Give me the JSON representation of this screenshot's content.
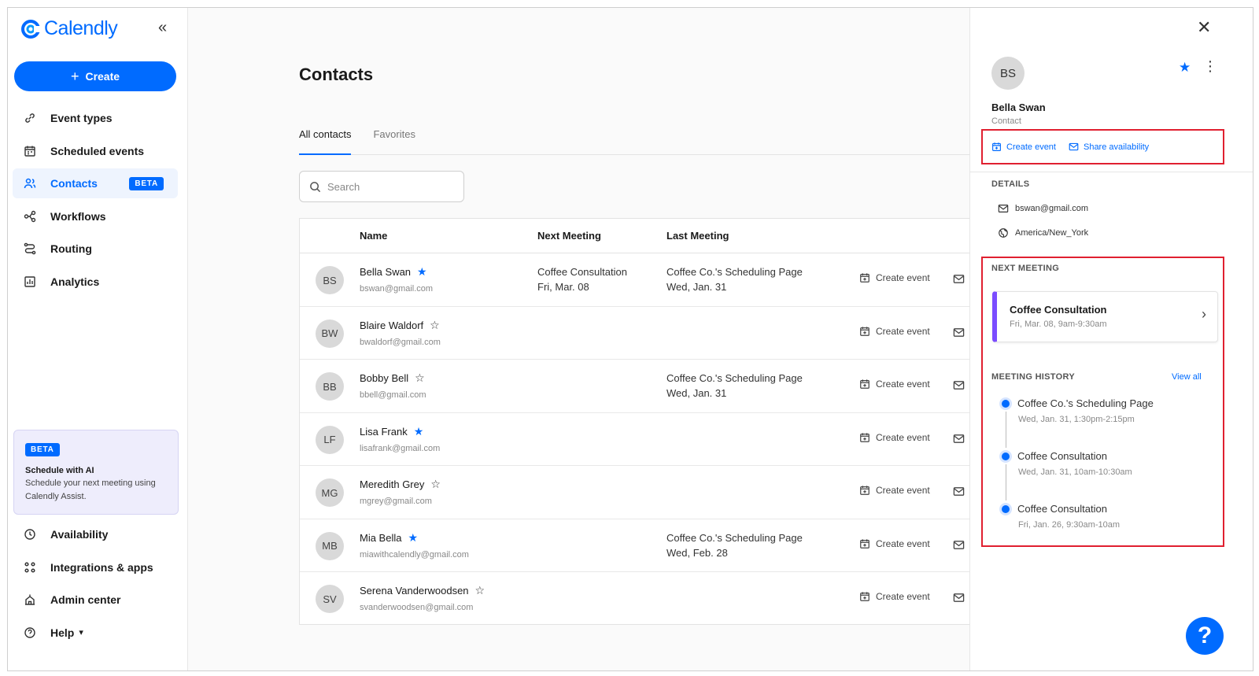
{
  "app": {
    "logo_text": "Calendly",
    "collapse_glyph": "«"
  },
  "sidebar": {
    "create_label": "Create",
    "items": [
      {
        "label": "Event types",
        "icon": "link-icon"
      },
      {
        "label": "Scheduled events",
        "icon": "calendar-icon"
      },
      {
        "label": "Contacts",
        "icon": "contacts-icon",
        "badge": "BETA",
        "active": true
      },
      {
        "label": "Workflows",
        "icon": "workflow-icon"
      },
      {
        "label": "Routing",
        "icon": "routing-icon"
      },
      {
        "label": "Analytics",
        "icon": "analytics-icon"
      }
    ],
    "ai_card": {
      "badge": "BETA",
      "title": "Schedule with AI",
      "description": "Schedule your next meeting using Calendly Assist."
    },
    "bottom_items": [
      {
        "label": "Availability",
        "icon": "clock-icon"
      },
      {
        "label": "Integrations & apps",
        "icon": "grid-icon"
      },
      {
        "label": "Admin center",
        "icon": "admin-icon"
      },
      {
        "label": "Help",
        "icon": "help-circle-icon",
        "caret": "▾"
      }
    ]
  },
  "main": {
    "title": "Contacts",
    "tabs": [
      {
        "label": "All contacts",
        "active": true
      },
      {
        "label": "Favorites"
      }
    ],
    "search_placeholder": "Search",
    "columns": {
      "name": "Name",
      "next": "Next Meeting",
      "last": "Last Meeting"
    },
    "row_action": "Create event",
    "contacts": [
      {
        "initials": "BS",
        "name": "Bella Swan",
        "email": "bswan@gmail.com",
        "favorite": true,
        "next_title": "Coffee Consultation",
        "next_date": "Fri, Mar. 08",
        "last_title": "Coffee Co.'s Scheduling Page",
        "last_date": "Wed, Jan. 31"
      },
      {
        "initials": "BW",
        "name": "Blaire Waldorf",
        "email": "bwaldorf@gmail.com",
        "favorite": false,
        "next_title": "",
        "next_date": "",
        "last_title": "",
        "last_date": ""
      },
      {
        "initials": "BB",
        "name": "Bobby Bell",
        "email": "bbell@gmail.com",
        "favorite": false,
        "next_title": "",
        "next_date": "",
        "last_title": "Coffee Co.'s Scheduling Page",
        "last_date": "Wed, Jan. 31"
      },
      {
        "initials": "LF",
        "name": "Lisa Frank",
        "email": "lisafrank@gmail.com",
        "favorite": true,
        "next_title": "",
        "next_date": "",
        "last_title": "",
        "last_date": ""
      },
      {
        "initials": "MG",
        "name": "Meredith Grey",
        "email": "mgrey@gmail.com",
        "favorite": false,
        "next_title": "",
        "next_date": "",
        "last_title": "",
        "last_date": ""
      },
      {
        "initials": "MB",
        "name": "Mia Bella",
        "email": "miawithcalendly@gmail.com",
        "favorite": true,
        "next_title": "",
        "next_date": "",
        "last_title": "Coffee Co.'s Scheduling Page",
        "last_date": "Wed, Feb. 28"
      },
      {
        "initials": "SV",
        "name": "Serena Vanderwoodsen",
        "email": "svanderwoodsen@gmail.com",
        "favorite": false,
        "next_title": "",
        "next_date": "",
        "last_title": "",
        "last_date": ""
      }
    ]
  },
  "panel": {
    "initials": "BS",
    "name": "Bella Swan",
    "role": "Contact",
    "favorite": true,
    "actions": {
      "create_event": "Create event",
      "share_availability": "Share availability"
    },
    "details_label": "DETAILS",
    "email": "bswan@gmail.com",
    "timezone": "America/New_York",
    "next_meeting_label": "NEXT MEETING",
    "next_meeting": {
      "title": "Coffee Consultation",
      "time": "Fri, Mar. 08, 9am-9:30am",
      "color": "#7b4cff"
    },
    "history_label": "MEETING HISTORY",
    "view_all": "View all",
    "history": [
      {
        "title": "Coffee Co.'s Scheduling Page",
        "time": "Wed, Jan. 31, 1:30pm-2:15pm"
      },
      {
        "title": "Coffee Consultation",
        "time": "Wed, Jan. 31, 10am-10:30am"
      },
      {
        "title": "Coffee Consultation",
        "time": "Fri, Jan. 26, 9:30am-10am"
      }
    ],
    "help_glyph": "?"
  },
  "colors": {
    "accent": "#006bff",
    "highlight": "#e02030",
    "event_purple": "#7b4cff"
  }
}
